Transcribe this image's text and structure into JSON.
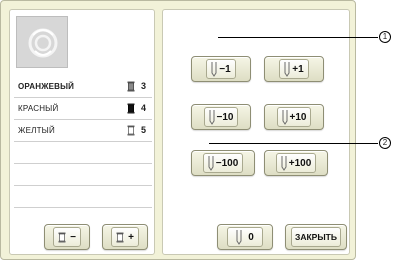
{
  "threads": [
    {
      "name": "ОРАНЖЕВЫЙ",
      "count": "3",
      "spool": "gray"
    },
    {
      "name": "КРАСНЫЙ",
      "count": "4",
      "spool": "dark"
    },
    {
      "name": "ЖЕЛТЫЙ",
      "count": "5",
      "spool": "white"
    }
  ],
  "buttons": {
    "minus1": "−1",
    "plus1": "+1",
    "minus10": "−10",
    "plus10": "+10",
    "minus100": "−100",
    "plus100": "+100",
    "zero": "0",
    "close": "ЗАКРЫТЬ",
    "thread_minus": "−",
    "thread_plus": "+"
  },
  "callouts": {
    "one": "1",
    "two": "2"
  },
  "icons": [
    "embroidery-thumbnail-icon",
    "thread-spool-icon",
    "needle-icon"
  ]
}
